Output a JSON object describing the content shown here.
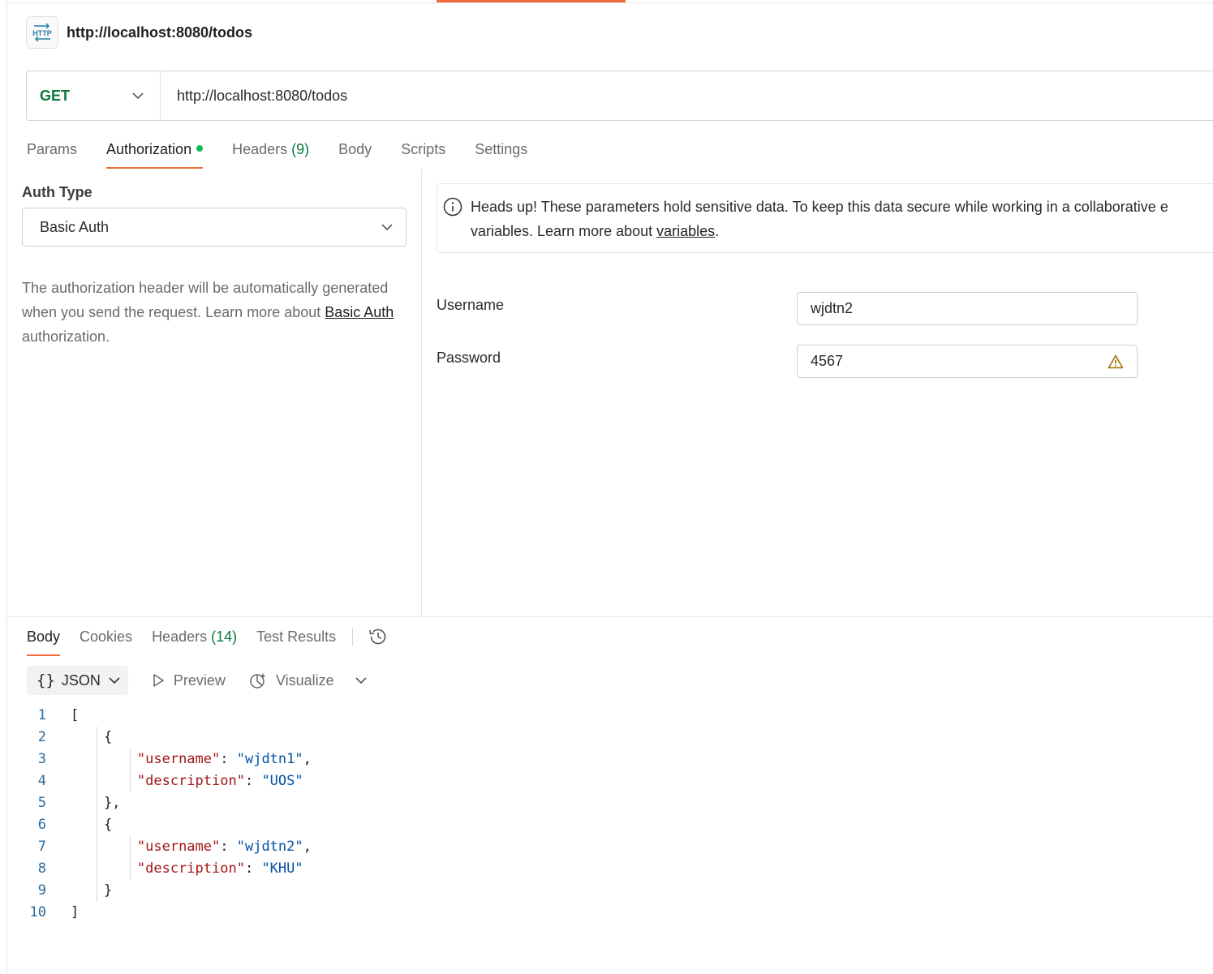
{
  "request": {
    "title": "http://localhost:8080/todos",
    "badge_label": "HTTP",
    "method": "GET",
    "url": "http://localhost:8080/todos"
  },
  "request_tabs": [
    {
      "label": "Params"
    },
    {
      "label": "Authorization",
      "has_dot": true,
      "active": true
    },
    {
      "label": "Headers",
      "count": "(9)"
    },
    {
      "label": "Body"
    },
    {
      "label": "Scripts"
    },
    {
      "label": "Settings"
    }
  ],
  "auth": {
    "type_label": "Auth Type",
    "type_value": "Basic Auth",
    "desc_before": "The authorization header will be automatically generated when you send the request. Learn more about ",
    "desc_link": "Basic Auth",
    "desc_after": " authorization.",
    "info_line1": "Heads up! These parameters hold sensitive data. To keep this data secure while working in a collaborative e",
    "info_line2_before": "variables. Learn more about ",
    "info_link": "variables",
    "info_line2_after": ".",
    "username_label": "Username",
    "username_value": "wjdtn2",
    "password_label": "Password",
    "password_value": "4567"
  },
  "response_tabs": [
    {
      "label": "Body",
      "active": true
    },
    {
      "label": "Cookies"
    },
    {
      "label": "Headers",
      "count": "(14)"
    },
    {
      "label": "Test Results"
    }
  ],
  "response_format": {
    "brace_label": "{}",
    "format": "JSON",
    "preview": "Preview",
    "visualize": "Visualize"
  },
  "code_lines": [
    {
      "n": "1",
      "parts": [
        [
          "t",
          "["
        ]
      ]
    },
    {
      "n": "2",
      "parts": [
        [
          "t",
          "    {"
        ]
      ]
    },
    {
      "n": "3",
      "parts": [
        [
          "t",
          "        "
        ],
        [
          "k",
          "\"username\""
        ],
        [
          "t",
          ": "
        ],
        [
          "s",
          "\"wjdtn1\""
        ],
        [
          "t",
          ","
        ]
      ]
    },
    {
      "n": "4",
      "parts": [
        [
          "t",
          "        "
        ],
        [
          "k",
          "\"description\""
        ],
        [
          "t",
          ": "
        ],
        [
          "s",
          "\"UOS\""
        ]
      ]
    },
    {
      "n": "5",
      "parts": [
        [
          "t",
          "    },"
        ]
      ]
    },
    {
      "n": "6",
      "parts": [
        [
          "t",
          "    {"
        ]
      ]
    },
    {
      "n": "7",
      "parts": [
        [
          "t",
          "        "
        ],
        [
          "k",
          "\"username\""
        ],
        [
          "t",
          ": "
        ],
        [
          "s",
          "\"wjdtn2\""
        ],
        [
          "t",
          ","
        ]
      ]
    },
    {
      "n": "8",
      "parts": [
        [
          "t",
          "        "
        ],
        [
          "k",
          "\"description\""
        ],
        [
          "t",
          ": "
        ],
        [
          "s",
          "\"KHU\""
        ]
      ]
    },
    {
      "n": "9",
      "parts": [
        [
          "t",
          "    }"
        ]
      ]
    },
    {
      "n": "10",
      "parts": [
        [
          "t",
          "]"
        ]
      ]
    }
  ],
  "icons": {
    "http_badge": "http-icon",
    "method_chevron": "chevron-down-icon",
    "info": "info-icon",
    "warning": "warning-icon",
    "history": "history-icon",
    "preview": "play-icon",
    "visualize": "visualize-icon"
  },
  "colors": {
    "accent": "#f26b3a",
    "method_get": "#0b7a3b",
    "active_dot": "#0cbb52",
    "json_key": "#a31515",
    "json_string": "#0451a5",
    "line_number": "#2b6a9a",
    "warning": "#b8860b"
  }
}
